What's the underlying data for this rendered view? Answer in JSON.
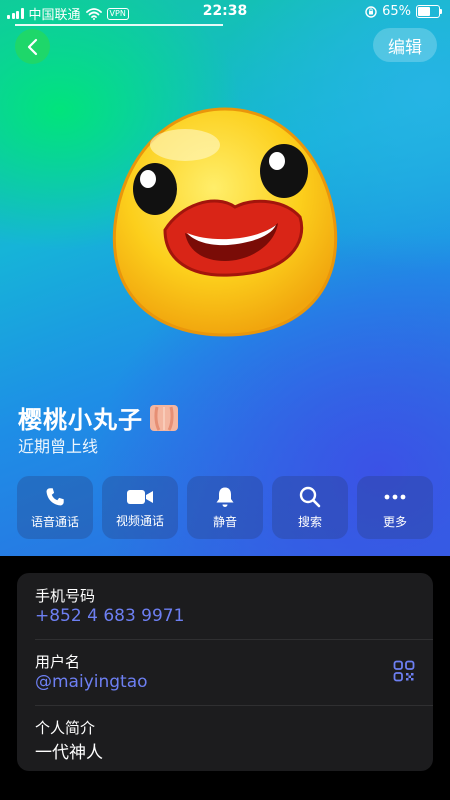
{
  "status_bar": {
    "carrier": "中国联通",
    "vpn": "VPN",
    "time": "22:38",
    "battery": "65%",
    "battery_level": 0.65
  },
  "header": {
    "back_icon": "chevron-left-icon",
    "edit_label": "编辑"
  },
  "profile": {
    "name": "樱桃小丸子",
    "status": "近期曾上线"
  },
  "actions": [
    {
      "label": "语音通话",
      "icon": "phone-icon"
    },
    {
      "label": "视频通话",
      "icon": "video-camera-icon"
    },
    {
      "label": "静音",
      "icon": "bell-icon"
    },
    {
      "label": "搜索",
      "icon": "search-icon"
    },
    {
      "label": "更多",
      "icon": "more-icon"
    }
  ],
  "info": {
    "phone_title": "手机号码",
    "phone_value": "+852 4 683 9971",
    "username_title": "用户名",
    "username_value": "@maiyingtao",
    "bio_title": "个人简介",
    "bio_value": "一代神人"
  },
  "colors": {
    "back_button": "#1ed76a",
    "link": "#6d7ff2",
    "card": "#1c1c1e"
  }
}
